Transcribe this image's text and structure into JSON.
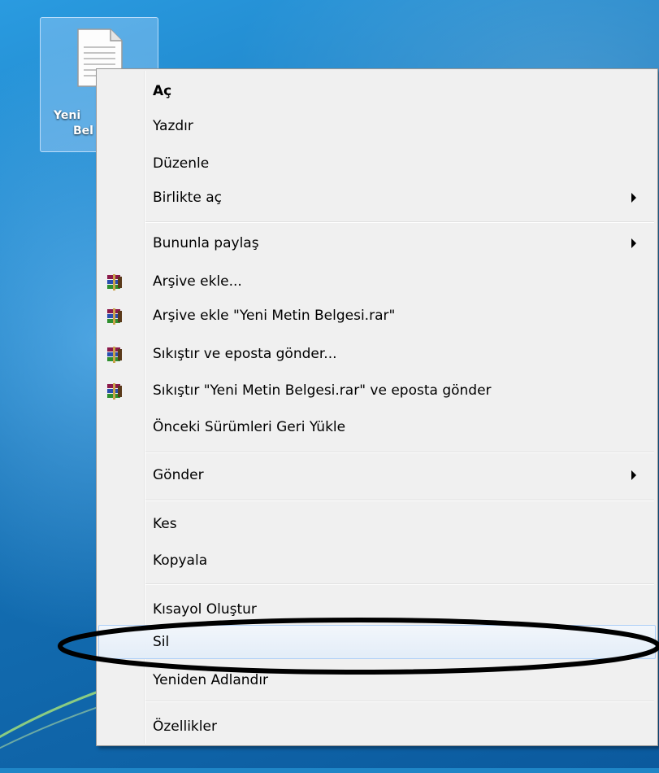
{
  "desktop": {
    "file": {
      "name_line1": "Yeni",
      "name_line2": "Bel",
      "icon": "text-document-icon"
    }
  },
  "context_menu": {
    "items": [
      {
        "label": "Aç",
        "bold": true
      },
      {
        "label": "Yazdır"
      },
      {
        "label": "Düzenle"
      },
      {
        "label": "Birlikte aç",
        "submenu": true
      },
      {
        "label": "Bununla paylaş",
        "submenu": true
      },
      {
        "label": "Arşive ekle...",
        "icon": "winrar-icon"
      },
      {
        "label": "Arşive ekle \"Yeni Metin Belgesi.rar\"",
        "icon": "winrar-icon"
      },
      {
        "label": "Sıkıştır ve eposta gönder...",
        "icon": "winrar-icon"
      },
      {
        "label": "Sıkıştır \"Yeni Metin Belgesi.rar\" ve eposta gönder",
        "icon": "winrar-icon"
      },
      {
        "label": "Önceki Sürümleri Geri Yükle"
      },
      {
        "label": "Gönder",
        "submenu": true
      },
      {
        "label": "Kes"
      },
      {
        "label": "Kopyala"
      },
      {
        "label": "Kısayol Oluştur"
      },
      {
        "label": "Sil",
        "highlighted": true
      },
      {
        "label": "Yeniden Adlandır"
      },
      {
        "label": "Özellikler"
      }
    ]
  },
  "colors": {
    "menu_background": "#f0f0f0",
    "hover_border": "#aecff7",
    "annotation_ellipse": "#000000"
  }
}
